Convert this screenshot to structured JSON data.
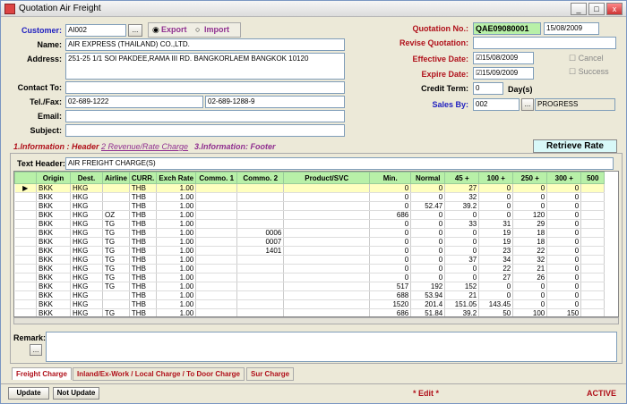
{
  "window": {
    "title": "Quotation Air Freight",
    "min": "_",
    "max": "□",
    "close": "x"
  },
  "customer": {
    "label": "Customer:",
    "code": "AI002",
    "browse": "...",
    "name_label": "Name:",
    "name": "AIR EXPRESS (THAILAND) CO.,LTD.",
    "address_label": "Address:",
    "address": "251-25 1/1 SOI PAKDEE,RAMA III RD. BANGKORLAEM BANGKOK 10120",
    "contact_label": "Contact To:",
    "contact": "",
    "telfax_label": "Tel./Fax:",
    "tel": "02-689-1222",
    "fax": "02-689-1288-9",
    "email_label": "Email:",
    "email": "",
    "subject_label": "Subject:",
    "subject": ""
  },
  "mode": {
    "export": "Export",
    "import": "Import",
    "selected": "Export"
  },
  "quotation": {
    "no_label": "Quotation No.:",
    "no": "QAE09080001",
    "date": "15/08/2009",
    "revise_label": "Revise Quotation:",
    "revise": "",
    "eff_label": "Effective Date:",
    "eff": "15/08/2009",
    "exp_label": "Expire Date:",
    "exp": "15/09/2009",
    "credit_label": "Credit Term:",
    "credit": "0",
    "days": "Day(s)",
    "sales_label": "Sales By:",
    "sales_code": "002",
    "sales_name": "PROGRESS",
    "cancel": "Cancel",
    "success": "Success",
    "browse": "..."
  },
  "tabs": [
    "1.Information : Header",
    "2 Revenue/Rate Charge",
    "3.Information: Footer"
  ],
  "retrieve": "Retrieve Rate",
  "text_header": {
    "label": "Text Header:",
    "value": "AIR FREIGHT CHARGE(S)"
  },
  "columns": [
    "",
    "Origin",
    "Dest.",
    "Airline",
    "CURR.",
    "Exch Rate",
    "Commo. 1",
    "Commo. 2",
    "Product/SVC",
    "Min.",
    "Normal",
    "45 +",
    "100 +",
    "250 +",
    "300 +",
    "500"
  ],
  "rows": [
    [
      "▶",
      "BKK",
      "HKG",
      "",
      "THB",
      "1.00",
      "",
      "",
      "",
      "0",
      "0",
      "27",
      "0",
      "0",
      "0",
      ""
    ],
    [
      "",
      "BKK",
      "HKG",
      "",
      "THB",
      "1.00",
      "",
      "",
      "",
      "0",
      "0",
      "32",
      "0",
      "0",
      "0",
      ""
    ],
    [
      "",
      "BKK",
      "HKG",
      "",
      "THB",
      "1.00",
      "",
      "",
      "",
      "0",
      "52.47",
      "39.2",
      "0",
      "0",
      "0",
      ""
    ],
    [
      "",
      "BKK",
      "HKG",
      "OZ",
      "THB",
      "1.00",
      "",
      "",
      "",
      "686",
      "0",
      "0",
      "0",
      "120",
      "0",
      ""
    ],
    [
      "",
      "BKK",
      "HKG",
      "TG",
      "THB",
      "1.00",
      "",
      "",
      "",
      "0",
      "0",
      "33",
      "31",
      "29",
      "0",
      ""
    ],
    [
      "",
      "BKK",
      "HKG",
      "TG",
      "THB",
      "1.00",
      "",
      "0006",
      "",
      "0",
      "0",
      "0",
      "19",
      "18",
      "0",
      ""
    ],
    [
      "",
      "BKK",
      "HKG",
      "TG",
      "THB",
      "1.00",
      "",
      "0007",
      "",
      "0",
      "0",
      "0",
      "19",
      "18",
      "0",
      ""
    ],
    [
      "",
      "BKK",
      "HKG",
      "TG",
      "THB",
      "1.00",
      "",
      "1401",
      "",
      "0",
      "0",
      "0",
      "23",
      "22",
      "0",
      ""
    ],
    [
      "",
      "BKK",
      "HKG",
      "TG",
      "THB",
      "1.00",
      "",
      "",
      "",
      "0",
      "0",
      "37",
      "34",
      "32",
      "0",
      ""
    ],
    [
      "",
      "BKK",
      "HKG",
      "TG",
      "THB",
      "1.00",
      "",
      "",
      "",
      "0",
      "0",
      "0",
      "22",
      "21",
      "0",
      ""
    ],
    [
      "",
      "BKK",
      "HKG",
      "TG",
      "THB",
      "1.00",
      "",
      "",
      "",
      "0",
      "0",
      "0",
      "27",
      "26",
      "0",
      ""
    ],
    [
      "",
      "BKK",
      "HKG",
      "TG",
      "THB",
      "1.00",
      "",
      "",
      "",
      "517",
      "192",
      "152",
      "0",
      "0",
      "0",
      ""
    ],
    [
      "",
      "BKK",
      "HKG",
      "",
      "THB",
      "1.00",
      "",
      "",
      "",
      "688",
      "53.94",
      "21",
      "0",
      "0",
      "0",
      ""
    ],
    [
      "",
      "BKK",
      "HKG",
      "",
      "THB",
      "1.00",
      "",
      "",
      "",
      "1520",
      "201.4",
      "151.05",
      "143.45",
      "0",
      "0",
      ""
    ],
    [
      "",
      "BKK",
      "HKG",
      "TG",
      "THB",
      "1.00",
      "",
      "",
      "",
      "686",
      "51.84",
      "39.2",
      "50",
      "100",
      "150",
      ""
    ]
  ],
  "remark": {
    "label": "Remark:",
    "browse": "..."
  },
  "bottom_tabs": [
    "Freight Charge",
    "Inland/Ex-Work / Local Charge / To Door Charge",
    "Sur Charge"
  ],
  "footer": {
    "update": "Update",
    "not_update": "Not Update",
    "edit": "* Edit *",
    "status": "ACTIVE"
  }
}
